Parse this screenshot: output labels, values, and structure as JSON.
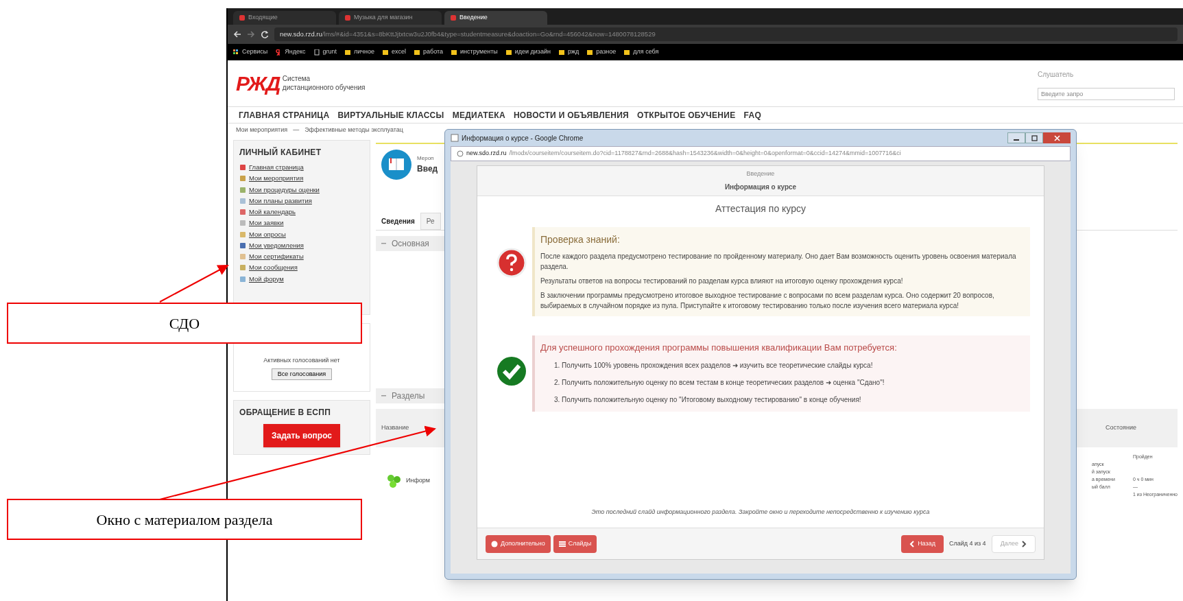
{
  "browser": {
    "tabs": [
      {
        "title": "Входящие",
        "selected": false
      },
      {
        "title": "Музыка для магазин",
        "selected": false
      },
      {
        "title": "Введение",
        "selected": true
      }
    ],
    "url_host": "new.sdo.rzd.ru",
    "url_path": "/lms/#&id=4351&s=8bKttJjtxtcw3u2J0fb4&type=studentmeasure&doaction=Go&rnd=456042&now=1480078128529",
    "bookmarks": [
      {
        "label": "Сервисы",
        "kind": "apps"
      },
      {
        "label": "Яндекс",
        "kind": "yandex"
      },
      {
        "label": "grunt",
        "kind": "page"
      },
      {
        "label": "личное",
        "kind": "folder"
      },
      {
        "label": "excel",
        "kind": "folder"
      },
      {
        "label": "работа",
        "kind": "folder"
      },
      {
        "label": "инструменты",
        "kind": "folder"
      },
      {
        "label": "идеи дизайн",
        "kind": "folder"
      },
      {
        "label": "ржд",
        "kind": "folder"
      },
      {
        "label": "разное",
        "kind": "folder"
      },
      {
        "label": "для себя",
        "kind": "folder"
      }
    ]
  },
  "site": {
    "logo_mark": "РЖД",
    "logo_line1": "Система",
    "logo_line2": "дистанционного обучения",
    "user_role": "Слушатель",
    "search": {
      "placeholder": "Введите запро"
    },
    "nav": [
      "ГЛАВНАЯ СТРАНИЦА",
      "ВИРТУАЛЬНЫЕ КЛАССЫ",
      "МЕДИАТЕКА",
      "НОВОСТИ И ОБЪЯВЛЕНИЯ",
      "ОТКРЫТОЕ ОБУЧЕНИЕ",
      "FAQ"
    ],
    "breadcrumb": [
      "Мои мероприятия",
      "Эффективные методы эксплуатац"
    ],
    "breadcrumb_separator": "—"
  },
  "sidebar": {
    "title": "ЛИЧНЫЙ КАБИНЕТ",
    "items": [
      "Главная страница",
      "Мои мероприятия",
      "Мои процедуры оценки",
      "Мои планы развития",
      "Мой календарь",
      "Мои заявки",
      "Мои опросы",
      "Мои уведомления",
      "Мои сертификаты",
      "Мои сообщения",
      "Мой форум"
    ],
    "votes_text": "Активных голосований нет",
    "votes_button": "Все голосования",
    "support_title": "ОБРАЩЕНИЕ В ЕСПП",
    "support_button": "Задать вопрос"
  },
  "main": {
    "event_label": "Мероп",
    "event_title": "Введ",
    "tabs": [
      {
        "label": "Сведения",
        "selected": true
      },
      {
        "label": "Ре",
        "selected": false
      }
    ],
    "section_main": "Основная",
    "section_parts": "Разделы",
    "column_name": "Название",
    "row_name": "Информ",
    "column_state": "Состояние",
    "state_value": "Пройден",
    "details": [
      {
        "label": "апуск"
      },
      {
        "label": "й запуск"
      },
      {
        "label": "а времени",
        "value": "0 ч 0 мин"
      },
      {
        "label": "ый балл",
        "value": "—"
      },
      {
        "value": "1 из Неограниченно"
      }
    ]
  },
  "popup": {
    "title": "Информация о курсе - Google Chrome",
    "url_host": "new.sdo.rzd.ru",
    "url_path": "/lmodx/courseitem/courseitem.do?cid=1178827&rnd=2688&hash=1543236&width=0&height=0&openformat=0&ccid=14274&mmid=1007716&ci",
    "subtitle": "Введение",
    "heading": "Информация о курсе",
    "slide_title": "Аттестация по курсу",
    "knowledge": {
      "title": "Проверка знаний:",
      "paragraphs": [
        "После каждого раздела предусмотрено тестирование по пройденному материалу. Оно дает Вам возможность оценить уровень освоения материала раздела.",
        "Результаты ответов на вопросы тестирований по разделам курса влияют на итоговую оценку прохождения курса!",
        "В заключении программы предусмотрено итоговое выходное тестирование с вопросами по всем разделам курса. Оно содержит 20 вопросов, выбираемых в случайном порядке из пула. Приступайте к итоговому тестированию только после изучения всего материала курса!"
      ]
    },
    "requirements": {
      "title": "Для успешного прохождения программы повышения квалификации Вам потребуется:",
      "items": [
        "1. Получить 100% уровень прохождения всех разделов ➜ изучить все теоретические слайды курса!",
        "2. Получить положительную оценку по всем тестам в конце теоретических разделов ➜ оценка \"Сдано\"!",
        "3. Получить положительную оценку по \"Итоговому выходному тестированию\" в конце обучения!"
      ]
    },
    "note": "Это последний слайд информационного раздела. Закройте окно и переходите непосредственно к изучению курса",
    "buttons_left": [
      "Дополнительно",
      "Слайды"
    ],
    "back": "Назад",
    "counter": "Слайд 4 из 4",
    "next": {
      "label": "Далее",
      "disabled": true
    }
  },
  "callouts": [
    "СДО",
    "Окно с материалом раздела"
  ]
}
